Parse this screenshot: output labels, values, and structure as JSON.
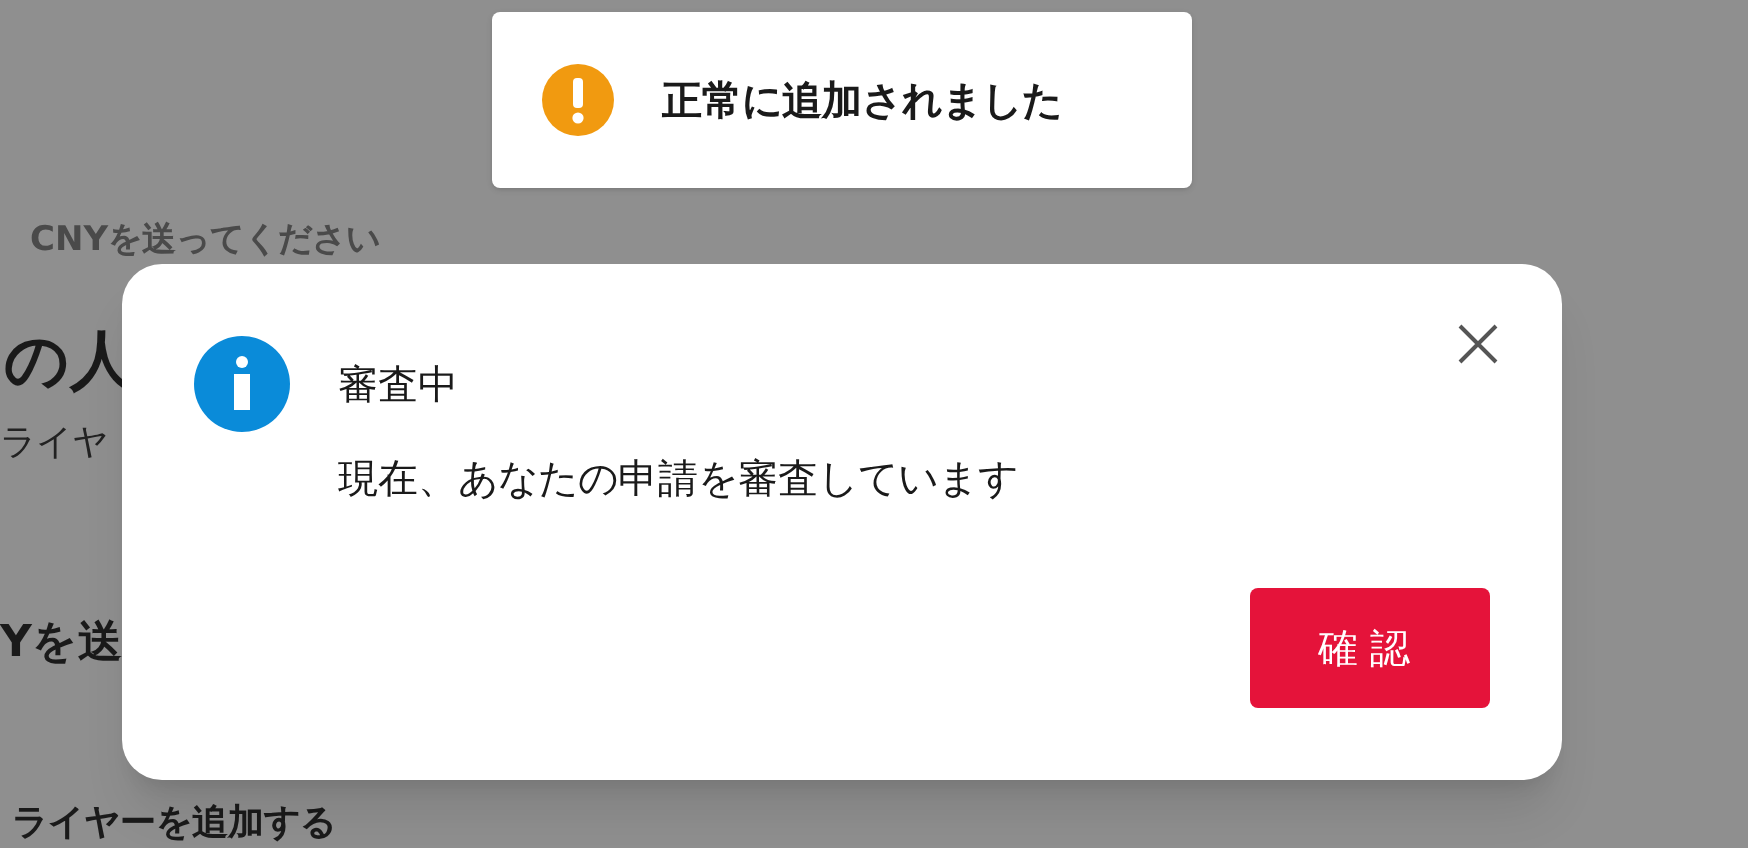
{
  "background": {
    "subtitle": "CNYを送ってください",
    "heading": "の人",
    "line": "ライヤ",
    "heading_2": "Yを送",
    "section": "ライヤーを追加する"
  },
  "toast": {
    "kind": "warning",
    "message": "正常に追加されました"
  },
  "dialog": {
    "kind": "info",
    "title": "審査中",
    "message": "現在、あなたの申請を審査しています",
    "confirm_button": "確認"
  }
}
